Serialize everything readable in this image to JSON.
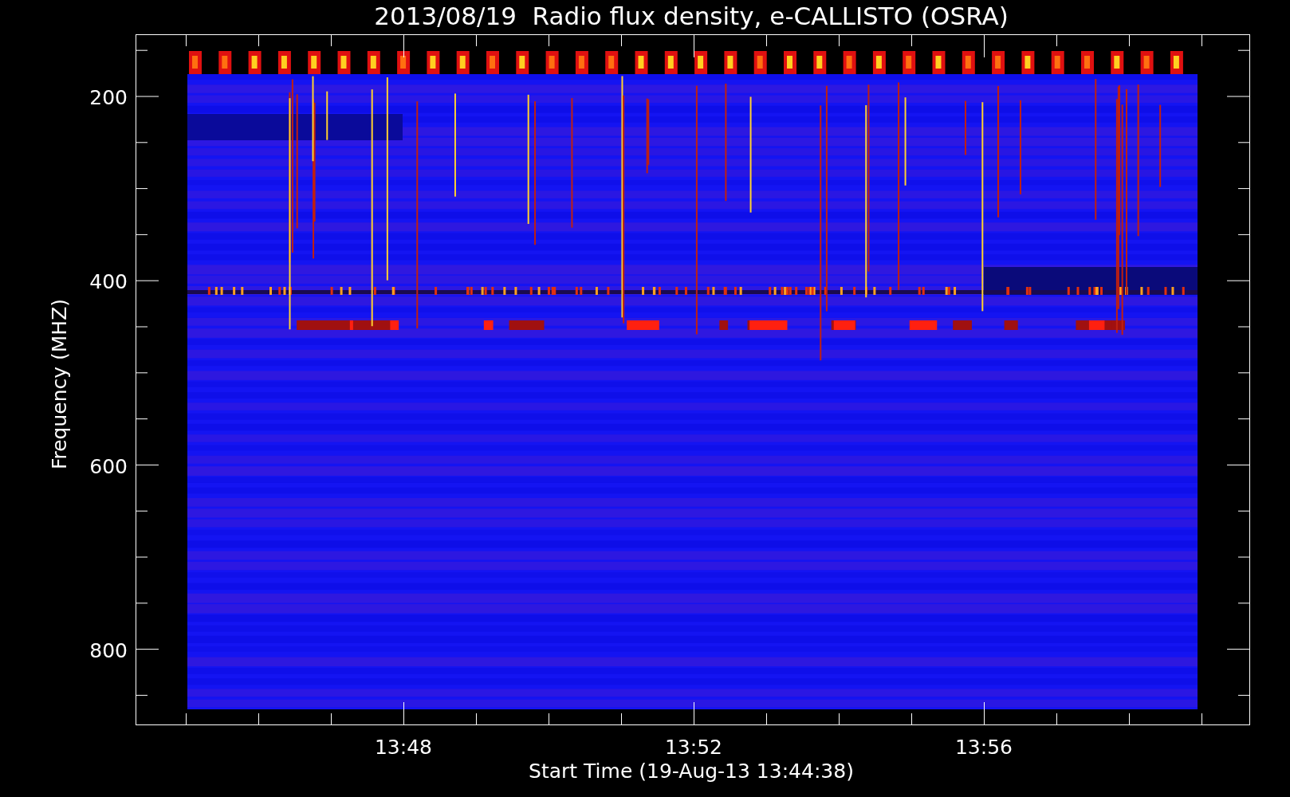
{
  "title": "2013/08/19  Radio flux density, e-CALLISTO (OSRA)",
  "ylabel": "Frequency (MHZ)",
  "xlabel": "Start Time (19-Aug-13 13:44:38)",
  "yticks": [
    "200",
    "400",
    "600",
    "800"
  ],
  "xticks": [
    "13:48",
    "13:52",
    "13:56"
  ]
}
